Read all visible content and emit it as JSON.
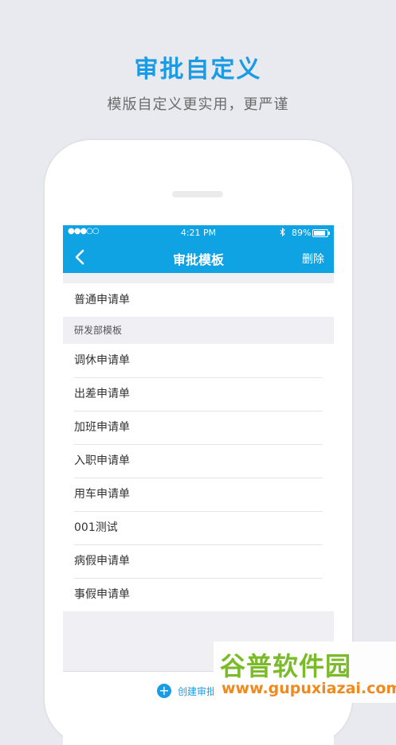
{
  "promo": {
    "title": "审批自定义",
    "subtitle": "模版自定义更实用，更严谨"
  },
  "status_bar": {
    "signal": "●●●○○",
    "time": "4:21 PM",
    "bluetooth_icon": "bluetooth-icon",
    "battery": "89%",
    "battery_level": 0.89
  },
  "nav": {
    "back_icon": "chevron-left-icon",
    "title": "审批模板",
    "action": "删除"
  },
  "general_items": [
    {
      "label": "普通申请单"
    }
  ],
  "section": {
    "header": "研发部模板",
    "items": [
      {
        "label": "调休申请单"
      },
      {
        "label": "出差申请单"
      },
      {
        "label": "加班申请单"
      },
      {
        "label": "入职申请单"
      },
      {
        "label": "用车申请单"
      },
      {
        "label": "001测试"
      },
      {
        "label": "病假申请单"
      },
      {
        "label": "事假申请单"
      }
    ]
  },
  "bottom": {
    "create_label": "创建审批"
  },
  "watermark": {
    "name": "谷普软件园",
    "url": "www.gupuxiazai.com"
  },
  "colors": {
    "accent": "#0fa3e4",
    "background": "#e9eaef"
  }
}
